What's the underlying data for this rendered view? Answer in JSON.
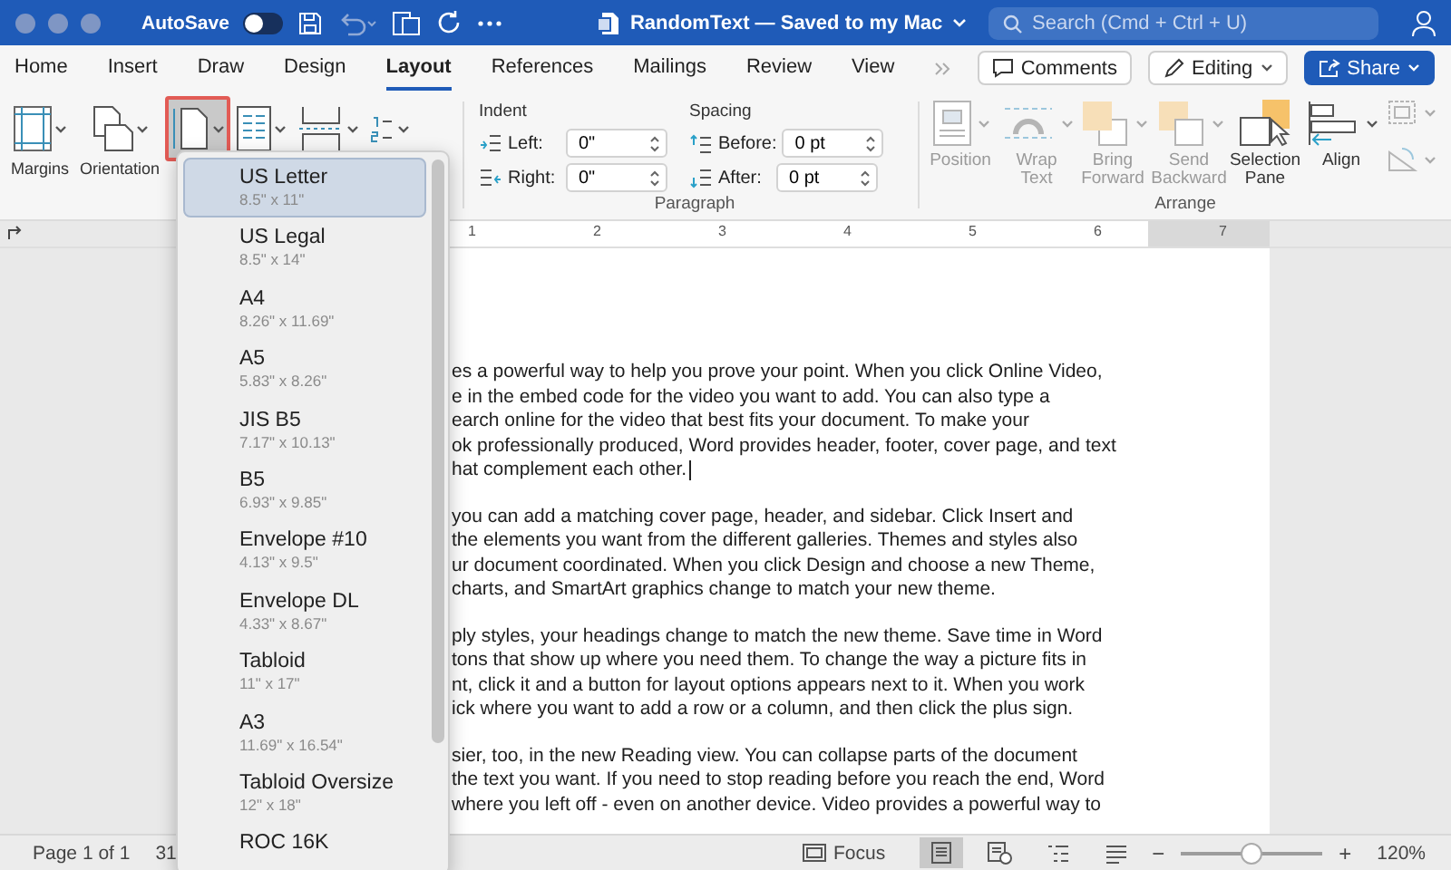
{
  "window": {
    "title": "RandomText — Saved to my Mac",
    "autosave": {
      "label": "AutoSave",
      "on": false
    },
    "search": {
      "placeholder": "Search (Cmd + Ctrl + U)"
    }
  },
  "tabs": [
    {
      "label": "Home",
      "selected": false
    },
    {
      "label": "Insert",
      "selected": false
    },
    {
      "label": "Draw",
      "selected": false
    },
    {
      "label": "Design",
      "selected": false
    },
    {
      "label": "Layout",
      "selected": true
    },
    {
      "label": "References",
      "selected": false
    },
    {
      "label": "Mailings",
      "selected": false
    },
    {
      "label": "Review",
      "selected": false
    },
    {
      "label": "View",
      "selected": false
    }
  ],
  "actions": {
    "comments": "Comments",
    "editing": "Editing",
    "share": "Share"
  },
  "page_setup": [
    {
      "kind": "margins",
      "label": "Margins",
      "expanded": false
    },
    {
      "kind": "orientation",
      "label": "Orientation",
      "expanded": false
    },
    {
      "kind": "size",
      "expanded": true
    },
    {
      "kind": "columns",
      "expanded": false
    },
    {
      "kind": "breaks",
      "expanded": false
    },
    {
      "kind": "line_numbers",
      "expanded": false
    }
  ],
  "paragraph": {
    "title": "Paragraph",
    "indent": {
      "title": "Indent",
      "fields": [
        {
          "kind": "left",
          "label": "Left:",
          "value": "0\""
        },
        {
          "kind": "right",
          "label": "Right:",
          "value": "0\""
        }
      ]
    },
    "spacing": {
      "title": "Spacing",
      "fields": [
        {
          "kind": "before",
          "label": "Before:",
          "value": "0 pt"
        },
        {
          "kind": "after",
          "label": "After:",
          "value": "0 pt"
        }
      ]
    }
  },
  "arrange": {
    "title": "Arrange",
    "items": [
      {
        "kind": "position",
        "label": "Position",
        "disabled": true
      },
      {
        "kind": "wrap",
        "label": "Wrap Text",
        "disabled": true
      },
      {
        "kind": "forward",
        "label": "Bring Forward",
        "disabled": true
      },
      {
        "kind": "backward",
        "label": "Send Backward",
        "disabled": true
      },
      {
        "kind": "selection",
        "label": "Selection Pane",
        "disabled": false
      },
      {
        "kind": "align",
        "label": "Align",
        "disabled": false
      }
    ],
    "small": [
      {
        "kind": "group",
        "disabled": true
      },
      {
        "kind": "rotate",
        "disabled": true
      }
    ]
  },
  "ruler": {
    "numbers": [
      "1",
      "2",
      "3",
      "4",
      "5",
      "6",
      "7"
    ]
  },
  "size_menu": {
    "items": [
      {
        "name": "US Letter",
        "size": "8.5\" x 11\"",
        "selected": true
      },
      {
        "name": "US Legal",
        "size": "8.5\" x 14\"",
        "selected": false
      },
      {
        "name": "A4",
        "size": "8.26\" x 11.69\"",
        "selected": false
      },
      {
        "name": "A5",
        "size": "5.83\" x 8.26\"",
        "selected": false
      },
      {
        "name": "JIS B5",
        "size": "7.17\" x 10.13\"",
        "selected": false
      },
      {
        "name": "B5",
        "size": "6.93\" x 9.85\"",
        "selected": false
      },
      {
        "name": "Envelope #10",
        "size": "4.13\" x 9.5\"",
        "selected": false
      },
      {
        "name": "Envelope DL",
        "size": "4.33\" x 8.67\"",
        "selected": false
      },
      {
        "name": "Tabloid",
        "size": "11\" x 17\"",
        "selected": false
      },
      {
        "name": "A3",
        "size": "11.69\" x 16.54\"",
        "selected": false
      },
      {
        "name": "Tabloid Oversize",
        "size": "12\" x 18\"",
        "selected": false
      },
      {
        "name": "ROC 16K",
        "selected": false
      }
    ]
  },
  "document": {
    "paragraphs": [
      [
        "es a powerful way to help you prove your point. When you click Online Video,",
        "e in the embed code for the video you want to add. You can also type a",
        "earch online for the video that best fits your document. To make your",
        "ok professionally produced, Word provides header, footer, cover page, and text",
        "hat complement each other."
      ],
      [
        "you can add a matching cover page, header, and sidebar. Click Insert and",
        "the elements you want from the different galleries. Themes and styles also",
        "ur document coordinated. When you click Design and choose a new Theme,",
        "charts, and SmartArt graphics change to match your new theme."
      ],
      [
        "ply styles, your headings change to match the new theme. Save time in Word",
        "tons that show up where you need them. To change the way a picture fits in",
        "nt, click it and a button for layout options appears next to it. When you work",
        "ick where you want to add a row or a column, and then click the plus sign."
      ],
      [
        "sier, too, in the new Reading view. You can collapse parts of the document",
        "the text you want. If you need to stop reading before you reach the end, Word",
        "where you left off - even on another device. Video provides a powerful way to"
      ]
    ]
  },
  "status_bar": {
    "page": "Page 1 of 1",
    "words": "31",
    "focus": "Focus",
    "views": [
      {
        "kind": "print",
        "selected": true
      },
      {
        "kind": "web",
        "selected": false
      },
      {
        "kind": "outline",
        "selected": false
      },
      {
        "kind": "draft",
        "selected": false
      }
    ],
    "zoom": {
      "minus": "−",
      "plus": "+",
      "level": 0.5,
      "reading": "120%"
    }
  }
}
